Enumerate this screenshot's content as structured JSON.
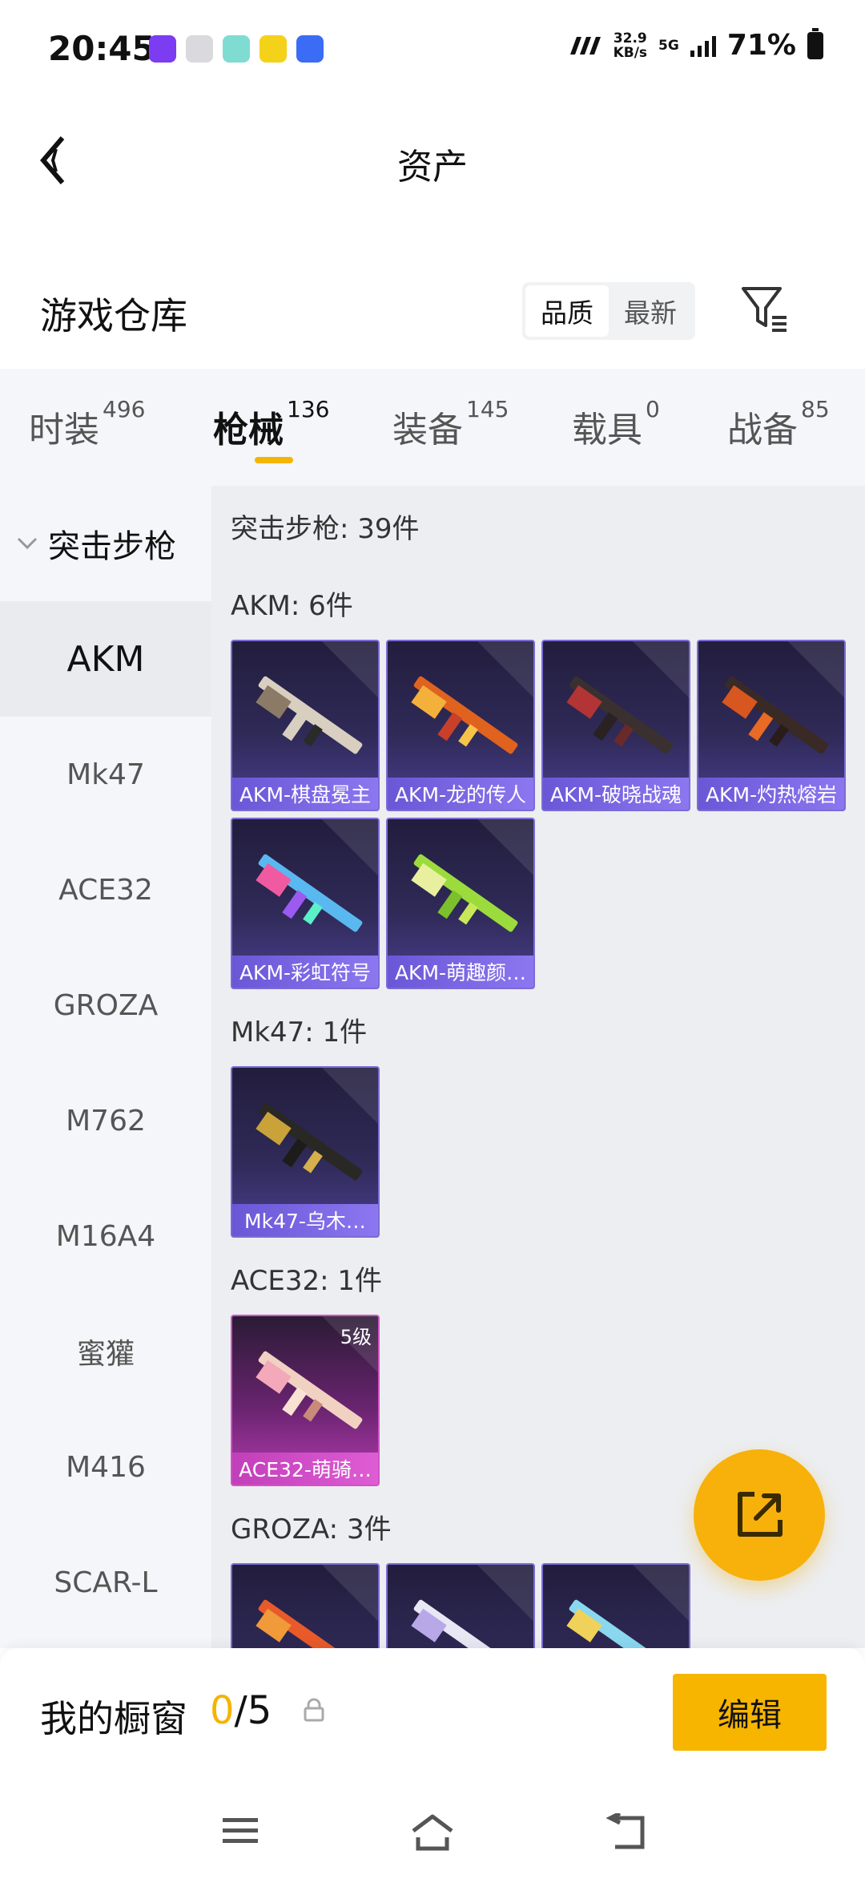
{
  "status_bar": {
    "time": "20:45",
    "net_speed_value": "32.9",
    "net_speed_unit": "KB/s",
    "network": "5G",
    "battery": "71%",
    "app_icon_colors": [
      "#7b3cf2",
      "#cfcfd6",
      "#33c7b9",
      "#f5d21a",
      "#3b6cf6"
    ]
  },
  "header": {
    "title": "资产",
    "back_icon": "back-arrow-icon"
  },
  "warehouse": {
    "title": "游戏仓库",
    "sort_options": [
      "品质",
      "最新"
    ],
    "active_sort": "品质",
    "filter_icon": "filter-icon"
  },
  "tabs": [
    {
      "label": "时装",
      "count": "496"
    },
    {
      "label": "枪械",
      "count": "136",
      "active": true
    },
    {
      "label": "装备",
      "count": "145"
    },
    {
      "label": "载具",
      "count": "0"
    },
    {
      "label": "战备",
      "count": "85"
    }
  ],
  "sidebar": {
    "group": "突击步枪",
    "items": [
      "AKM",
      "Mk47",
      "ACE32",
      "GROZA",
      "M762",
      "M16A4",
      "蜜獾",
      "M416",
      "SCAR-L"
    ],
    "active": "AKM"
  },
  "main": {
    "total": "突击步枪: 39件",
    "sections": [
      {
        "title": "AKM: 6件",
        "items": [
          "AKM-棋盘冕主",
          "AKM-龙的传人",
          "AKM-破晓战魂",
          "AKM-灼热熔岩",
          "AKM-彩虹符号",
          "AKM-萌趣颜…"
        ]
      },
      {
        "title": "Mk47: 1件",
        "items": [
          "Mk47-乌木…"
        ]
      },
      {
        "title": "ACE32: 1件",
        "items": [
          "ACE32-萌骑…"
        ],
        "level": "5级"
      },
      {
        "title": "GROZA: 3件",
        "items": [
          "",
          "",
          ""
        ]
      }
    ]
  },
  "showcase": {
    "title": "我的橱窗",
    "current": "0",
    "total": "/5",
    "edit_label": "编辑"
  },
  "colors": {
    "accent": "#f5b400",
    "card_purple": "#6a57d6",
    "card_pink": "#c23fba"
  }
}
